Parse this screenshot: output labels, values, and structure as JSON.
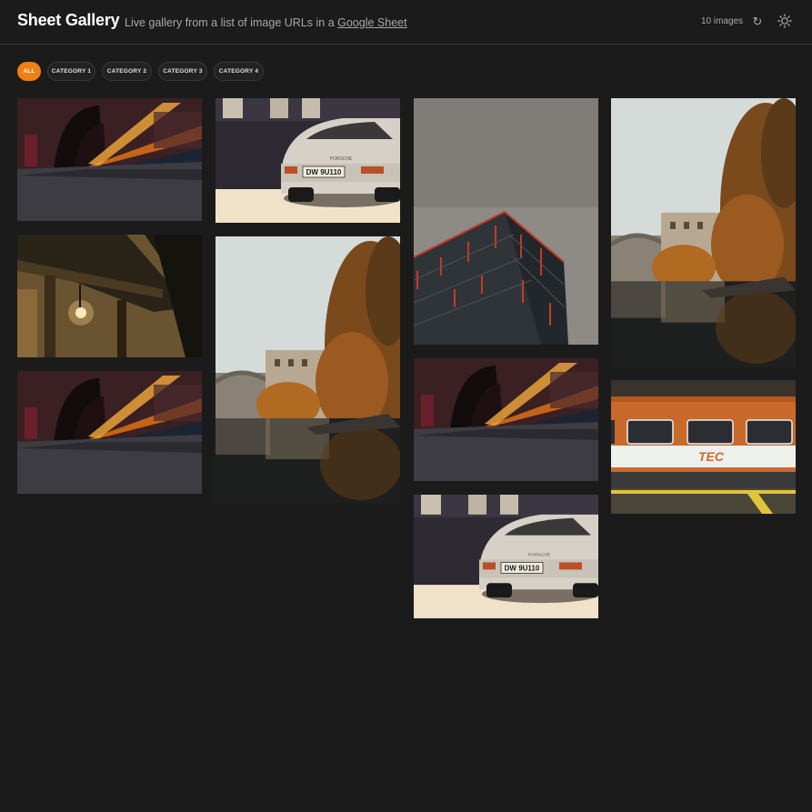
{
  "header": {
    "title": "Sheet Gallery",
    "subtitle_prefix": "Live gallery from a list of image URLs in a ",
    "subtitle_link": "Google Sheet",
    "image_count": "10 images",
    "refresh_icon": "↻",
    "theme_icon": "sun-icon"
  },
  "categories": [
    {
      "label": "ALL",
      "active": true
    },
    {
      "label": "CATEGORY 1",
      "active": false
    },
    {
      "label": "CATEGORY 2",
      "active": false
    },
    {
      "label": "CATEGORY 3",
      "active": false
    },
    {
      "label": "CATEGORY 4",
      "active": false
    }
  ],
  "images": [
    {
      "subject": "train-station-motion"
    },
    {
      "subject": "tunnel-building-lamp"
    },
    {
      "subject": "train-station-motion"
    },
    {
      "subject": "porsche-rear"
    },
    {
      "subject": "autumn-river-bridge"
    },
    {
      "subject": "red-striped-building"
    },
    {
      "subject": "train-station-motion"
    },
    {
      "subject": "porsche-rear"
    },
    {
      "subject": "autumn-river-bridge"
    },
    {
      "subject": "orange-train-tec"
    }
  ],
  "plates": {
    "porsche": "DW 9U110",
    "porsche_badge": "PORSCHE",
    "train_logo": "TEC"
  },
  "colors": {
    "accent": "#f07f14",
    "background": "#1b1b1b",
    "chip_bg": "#222222"
  }
}
